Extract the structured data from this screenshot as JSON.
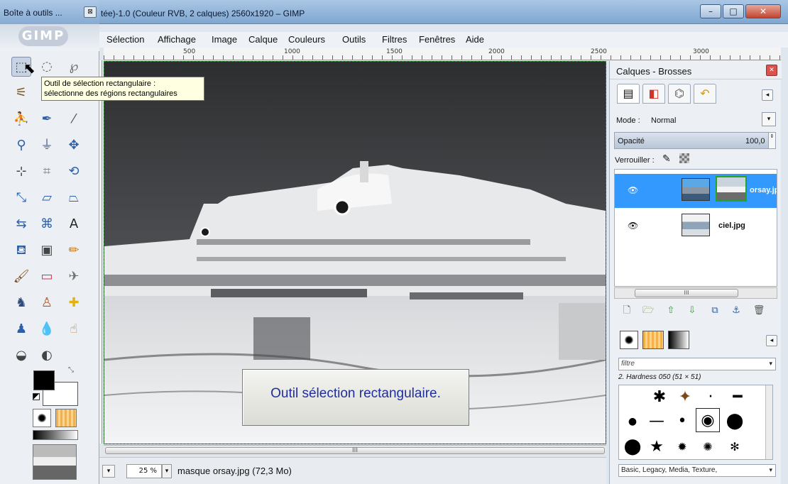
{
  "toolbox": {
    "title": "Boîte à outils ...",
    "close_glyph": "⊠",
    "logo_text": "GIMP",
    "tools": [
      {
        "name": "rect-select-icon",
        "glyph": "⬚",
        "color": "#444444"
      },
      {
        "name": "ellipse-select-icon",
        "glyph": "◌",
        "color": "#666666"
      },
      {
        "name": "free-select-icon",
        "glyph": "℘",
        "color": "#666666"
      },
      {
        "name": "fuzzy-select-icon",
        "glyph": "⚟",
        "color": "#7a5a1f"
      },
      {
        "name": "color-select-icon",
        "glyph": "◫",
        "color": "#b34a1a"
      },
      {
        "name": "scissors-select-icon",
        "glyph": "✂",
        "color": "#444444"
      },
      {
        "name": "foreground-select-icon",
        "glyph": "⛹",
        "color": "#b5531c"
      },
      {
        "name": "paths-icon",
        "glyph": "✒",
        "color": "#2d5fa8"
      },
      {
        "name": "color-picker-icon",
        "glyph": "⁄",
        "color": "#555555"
      },
      {
        "name": "zoom-icon",
        "glyph": "⚲",
        "color": "#2d5fa8"
      },
      {
        "name": "measure-icon",
        "glyph": "⏚",
        "color": "#445d85"
      },
      {
        "name": "move-icon",
        "glyph": "✥",
        "color": "#2d5fa8"
      },
      {
        "name": "align-icon",
        "glyph": "⊹",
        "color": "#444444"
      },
      {
        "name": "crop-icon",
        "glyph": "⌗",
        "color": "#888888"
      },
      {
        "name": "rotate-icon",
        "glyph": "⟲",
        "color": "#2d5fa8"
      },
      {
        "name": "scale-icon",
        "glyph": "⤡",
        "color": "#2d5fa8"
      },
      {
        "name": "shear-icon",
        "glyph": "▱",
        "color": "#2d5fa8"
      },
      {
        "name": "perspective-icon",
        "glyph": "⏢",
        "color": "#2d5fa8"
      },
      {
        "name": "flip-icon",
        "glyph": "⇆",
        "color": "#2d5fa8"
      },
      {
        "name": "cage-transform-icon",
        "glyph": "⌘",
        "color": "#2d5fa8"
      },
      {
        "name": "text-icon",
        "glyph": "A",
        "color": "#222222"
      },
      {
        "name": "bucket-fill-icon",
        "glyph": "⛾",
        "color": "#2d5fa8"
      },
      {
        "name": "blend-icon",
        "glyph": "▣",
        "color": "#444444"
      },
      {
        "name": "pencil-icon",
        "glyph": "✏",
        "color": "#c8781c"
      },
      {
        "name": "paintbrush-icon",
        "glyph": "🖌",
        "color": "#7a4a1a"
      },
      {
        "name": "eraser-icon",
        "glyph": "▭",
        "color": "#d6334a"
      },
      {
        "name": "airbrush-icon",
        "glyph": "✈",
        "color": "#6f6f6f"
      },
      {
        "name": "ink-icon",
        "glyph": "♞",
        "color": "#2d4a7a"
      },
      {
        "name": "clone-icon",
        "glyph": "♙",
        "color": "#b5531c"
      },
      {
        "name": "heal-icon",
        "glyph": "✚",
        "color": "#e0b315"
      },
      {
        "name": "perspective-clone-icon",
        "glyph": "♟",
        "color": "#2d5fa8"
      },
      {
        "name": "blur-icon",
        "glyph": "💧",
        "color": "#3d7ac4"
      },
      {
        "name": "smudge-icon",
        "glyph": "☝",
        "color": "#c8781c"
      },
      {
        "name": "dodge-burn-icon",
        "glyph": "◒",
        "color": "#444444"
      },
      {
        "name": "levels-icon",
        "glyph": "◐",
        "color": "#444444"
      }
    ]
  },
  "tooltip": {
    "line1": "Outil de sélection rectangulaire :",
    "line2": "sélectionne des régions rectangulaires"
  },
  "window": {
    "title": "tée)-1.0 (Couleur RVB, 2 calques) 2560x1920 – GIMP",
    "minimize_glyph": "–",
    "maximize_glyph": "□",
    "close_glyph": "✕"
  },
  "menubar": [
    "Sélection",
    "Affichage",
    "Image",
    "Calque",
    "Couleurs",
    "Outils",
    "Filtres",
    "Fenêtres",
    "Aide"
  ],
  "ruler": {
    "labels": [
      "500",
      "1000",
      "1500",
      "2000",
      "2500",
      "3000"
    ]
  },
  "canvas": {
    "caption": "Outil sélection rectangulaire."
  },
  "hscroll": {
    "grip": "III"
  },
  "statusbar": {
    "nav_glyph": "▾",
    "zoom": "25 %",
    "zoom_arrow": "▾",
    "text": "masque orsay.jpg (72,3 Mo)"
  },
  "dock": {
    "title": "Calques - Brosses",
    "close_glyph": "✕",
    "tabs": [
      "▤",
      "◧",
      "⌬",
      "↶"
    ],
    "menu_glyph": "◂",
    "mode_label": "Mode :",
    "mode_value": "Normal",
    "dropdown_glyph": "▾",
    "opacity_label": "Opacité",
    "opacity_value": "100,0",
    "spin_glyph": "⇕",
    "lock_label": "Verrouiller :",
    "lock_paint_glyph": "✎",
    "layers": [
      {
        "name": "orsay.jp",
        "visible_glyph": "👁",
        "selected": true
      },
      {
        "name": "ciel.jpg",
        "visible_glyph": "👁",
        "selected": false
      }
    ],
    "layers_scroll_grip": "III",
    "layer_actions": [
      {
        "name": "new-layer-icon",
        "glyph": "🗋"
      },
      {
        "name": "new-layer-group-icon",
        "glyph": "🗁"
      },
      {
        "name": "raise-layer-icon",
        "glyph": "⇧"
      },
      {
        "name": "lower-layer-icon",
        "glyph": "⇩"
      },
      {
        "name": "duplicate-layer-icon",
        "glyph": "⧉"
      },
      {
        "name": "anchor-layer-icon",
        "glyph": "⚓"
      },
      {
        "name": "delete-layer-icon",
        "glyph": "🗑"
      }
    ],
    "brushes_menu_glyph": "◂",
    "filter_placeholder": "filtre",
    "brush_name": "2. Hardness 050 (51 × 51)",
    "brushes": [
      "✱",
      "✦",
      "·",
      "━",
      "●",
      "—",
      "•",
      "◉",
      "⬤",
      "★",
      "✹",
      "✺",
      "✻"
    ],
    "tags_value": "Basic, Legacy, Media, Texture,"
  }
}
